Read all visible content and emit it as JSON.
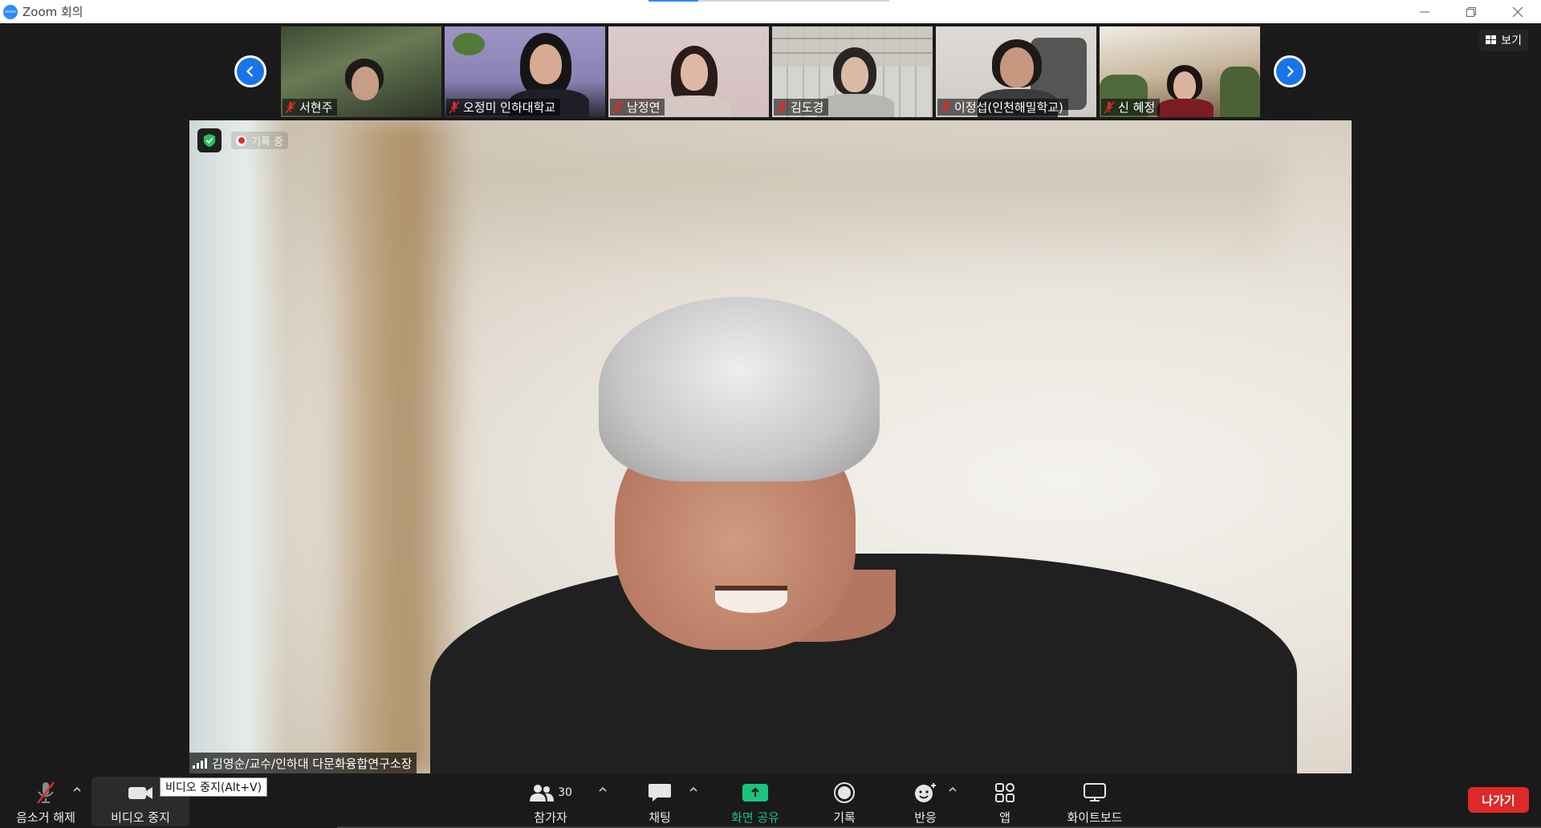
{
  "window": {
    "title": "Zoom 회의",
    "app_icon": "zoom-logo"
  },
  "view_button": {
    "label": "보기",
    "icon": "grid-icon"
  },
  "gallery": {
    "participants": [
      {
        "name": "서현주",
        "muted": true,
        "bg": "#4a5a3e"
      },
      {
        "name": "오정미 인하대학교",
        "muted": true,
        "bg": "#8f86b8"
      },
      {
        "name": "남정연",
        "muted": true,
        "bg": "#d9c6c6"
      },
      {
        "name": "김도경",
        "muted": true,
        "bg": "#c9c7c2"
      },
      {
        "name": "이정섭(인천해밀학교)",
        "muted": true,
        "bg": "#d9d6d2"
      },
      {
        "name": "신 혜정",
        "muted": true,
        "bg": "#c8b79e"
      }
    ]
  },
  "main_video": {
    "speaker_name": "김영순/교수/인하대 다문화융합연구소장",
    "recording_label": "기록 중"
  },
  "toolbar": {
    "unmute_label": "음소거 해제",
    "video_label": "비디오 중지",
    "video_tooltip": "비디오 중지(Alt+V)",
    "participants_label": "참가자",
    "participants_count": "30",
    "chat_label": "채팅",
    "share_label": "화면 공유",
    "record_label": "기록",
    "reactions_label": "반응",
    "apps_label": "앱",
    "whiteboard_label": "화이트보드",
    "leave_label": "나가기"
  },
  "colors": {
    "accent": "#2d8cff",
    "share_green": "#1bc47d",
    "leave_red": "#e02828",
    "muted_red": "#e02828"
  }
}
